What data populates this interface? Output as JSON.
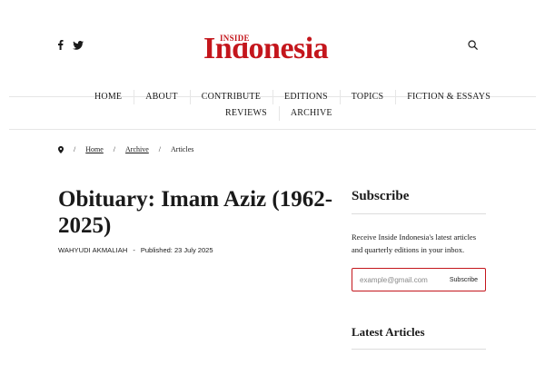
{
  "header": {
    "logo_small": "INSIDE",
    "logo_big": "Indonesia",
    "social": [
      "facebook-icon",
      "twitter-icon"
    ],
    "search_icon": "search-icon"
  },
  "nav": {
    "row1": [
      "HOME",
      "ABOUT",
      "CONTRIBUTE",
      "EDITIONS",
      "TOPICS",
      "FICTION & ESSAYS"
    ],
    "row2": [
      "REVIEWS",
      "ARCHIVE"
    ]
  },
  "breadcrumb": {
    "home": "Home",
    "archive": "Archive",
    "current": "Articles",
    "separator": "/"
  },
  "article": {
    "title": "Obituary: Imam Aziz (1962-2025)",
    "author": "WAHYUDI AKMALIAH",
    "dash": "-",
    "published": "Published: 23 July 2025"
  },
  "sidebar": {
    "subscribe_heading": "Subscribe",
    "subscribe_text": "Receive Inside Indonesia's latest articles and quarterly editions in your inbox.",
    "email_placeholder": "example@gmail.com",
    "subscribe_button": "Subscribe",
    "latest_heading": "Latest Articles"
  },
  "colors": {
    "brand": "#c4161c",
    "text": "#1a1a1a",
    "divider": "#e6e6e6"
  }
}
